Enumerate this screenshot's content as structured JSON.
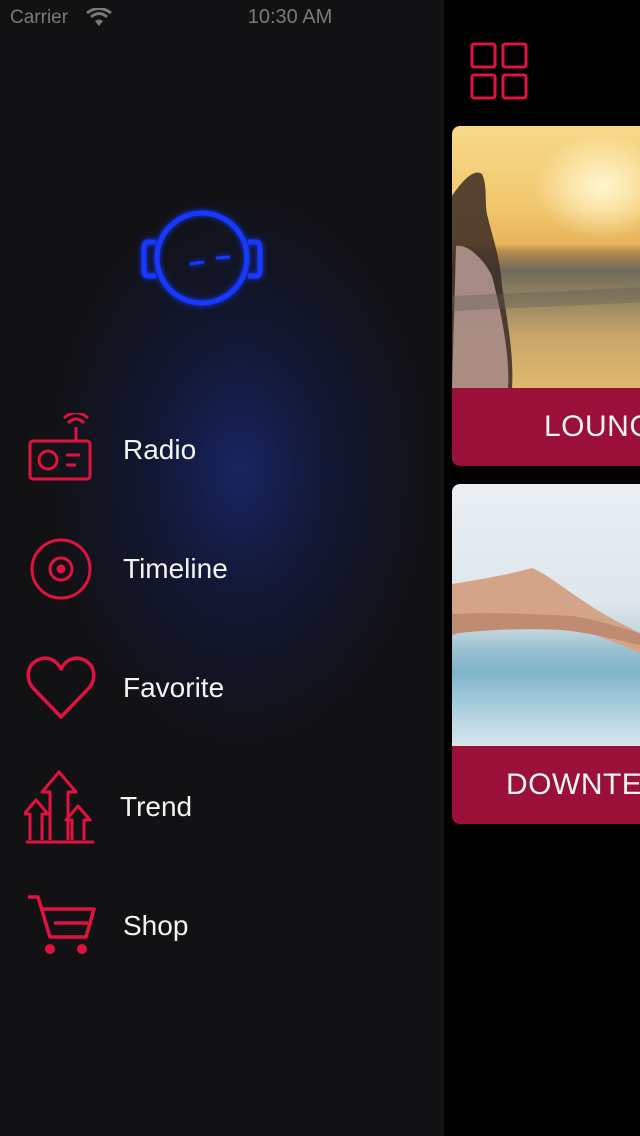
{
  "status_bar": {
    "carrier": "Carrier",
    "time": "10:30 AM"
  },
  "colors": {
    "accent": "#e0123f",
    "card_bar": "#9b1038",
    "logo_glow": "#1638ff",
    "drawer_bg": "#121214"
  },
  "content": {
    "grid_icon": "grid-icon",
    "cards": [
      {
        "title": "LOUNG"
      },
      {
        "title": "DOWNTE"
      }
    ]
  },
  "drawer": {
    "logo_icon": "headphones-face-logo",
    "menu": [
      {
        "label": "Radio",
        "icon": "radio-icon"
      },
      {
        "label": "Timeline",
        "icon": "disc-icon"
      },
      {
        "label": "Favorite",
        "icon": "heart-icon"
      },
      {
        "label": "Trend",
        "icon": "trend-arrows-icon"
      },
      {
        "label": "Shop",
        "icon": "cart-icon"
      }
    ]
  }
}
